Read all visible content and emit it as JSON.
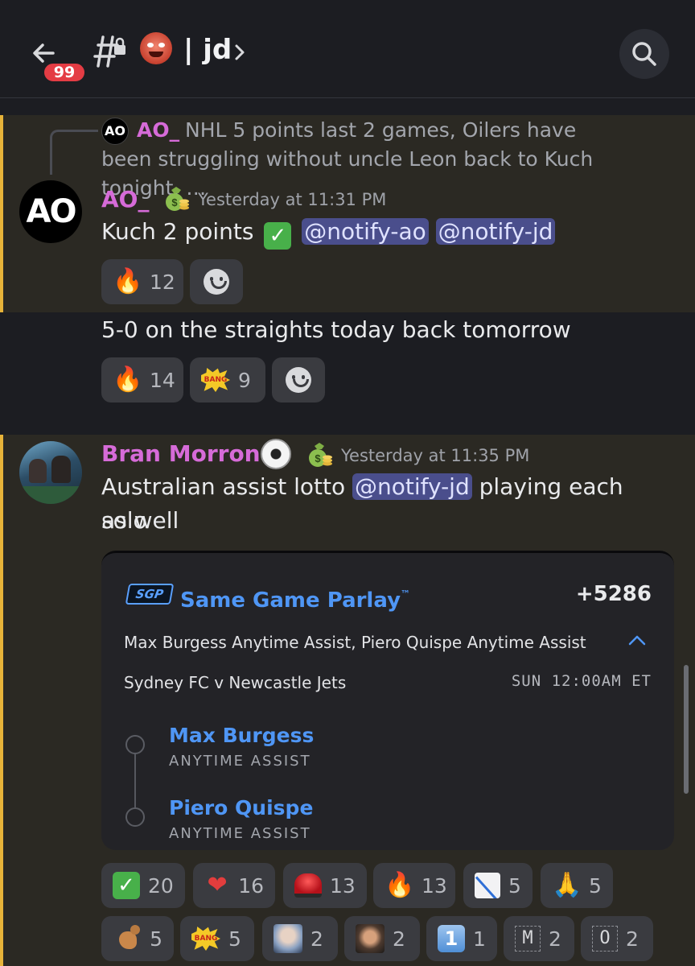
{
  "header": {
    "badge_count": "99",
    "channel_name": "| jd",
    "channel_emoji_icon": "ogre-icon",
    "icons": [
      "back-arrow-icon",
      "locked-channel-icon",
      "chevron-right-icon",
      "search-icon"
    ]
  },
  "messages": [
    {
      "reply_preview": {
        "author": "AO_",
        "avatar_text": "AO",
        "text": "NHL   5 points last 2 games, Oilers have been struggling without uncle Leon back to Kuch tonight.  …"
      },
      "author": "AO_",
      "author_color": "#d66bd8",
      "avatar_text": "AO",
      "timestamp": "Yesterday at 11:31 PM",
      "text_before": "Kuch 2 points",
      "check_icon": "✓",
      "mentions": [
        "@notify-ao",
        "@notify-jd"
      ],
      "reactions": [
        {
          "icon": "fire-icon",
          "emoji": "🔥",
          "count": "12"
        }
      ]
    },
    {
      "text": "5-0 on the straights today back tomorrow",
      "reactions": [
        {
          "icon": "fire-icon",
          "emoji": "🔥",
          "count": "14"
        },
        {
          "icon": "bang-icon",
          "emoji": "BANG",
          "count": "9"
        }
      ]
    },
    {
      "author": "Bran Morrone",
      "author_color": "#d66bd8",
      "timestamp": "Yesterday at 11:35 PM",
      "text_before": "Australian assist lotto",
      "mention": "@notify-jd",
      "text_after": "playing each solo",
      "text_line2": "as well",
      "embed": {
        "logo": "SGP",
        "title": "Same Game Parlay",
        "trademark": "™",
        "odds": "+5286",
        "legs_summary": "Max Burgess Anytime Assist, Piero Quispe Anytime Assist",
        "match": "Sydney FC v Newcastle Jets",
        "time": "SUN 12:00AM ET",
        "legs": [
          {
            "player": "Max Burgess",
            "market": "ANYTIME ASSIST"
          },
          {
            "player": "Piero Quispe",
            "market": "ANYTIME ASSIST"
          }
        ]
      },
      "reactions_row1": [
        {
          "icon": "check-icon",
          "emoji": "✓",
          "count": "20"
        },
        {
          "icon": "heart-icon",
          "emoji": "❤",
          "count": "16"
        },
        {
          "icon": "siren-icon",
          "emoji": "",
          "count": "13"
        },
        {
          "icon": "fire-icon",
          "emoji": "🔥",
          "count": "13"
        },
        {
          "icon": "chart-down-icon",
          "emoji": "",
          "count": "5"
        },
        {
          "icon": "pray-icon",
          "emoji": "🙏",
          "count": "5"
        }
      ],
      "reactions_row2": [
        {
          "icon": "kangaroo-icon",
          "emoji": "",
          "count": "5"
        },
        {
          "icon": "bang-icon",
          "emoji": "BANG",
          "count": "5"
        },
        {
          "icon": "face-photo-icon",
          "emoji": "",
          "count": "2"
        },
        {
          "icon": "face-photo-2-icon",
          "emoji": "",
          "count": "2"
        },
        {
          "icon": "keycap-one-icon",
          "emoji": "1",
          "count": "1"
        },
        {
          "icon": "letter-m-icon",
          "emoji": "M",
          "count": "2"
        },
        {
          "icon": "letter-o-icon",
          "emoji": "O",
          "count": "2"
        }
      ]
    }
  ]
}
